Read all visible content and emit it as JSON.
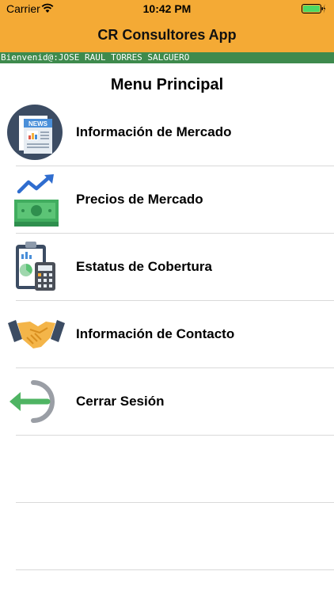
{
  "status_bar": {
    "carrier": "Carrier",
    "time": "10:42 PM",
    "wifi_icon": "wifi-icon",
    "battery_icon": "battery-charging-icon"
  },
  "navbar": {
    "title": "CR Consultores App"
  },
  "welcome": {
    "text": "Bienvenid@:JOSE RAUL TORRES SALGUERO"
  },
  "menu": {
    "title": "Menu Principal",
    "items": [
      {
        "label": "Información de Mercado",
        "icon": "news-icon"
      },
      {
        "label": "Precios de Mercado",
        "icon": "money-trend-icon"
      },
      {
        "label": "Estatus de Cobertura",
        "icon": "clipboard-calculator-icon"
      },
      {
        "label": "Información de Contacto",
        "icon": "handshake-icon"
      },
      {
        "label": "Cerrar Sesión",
        "icon": "logout-icon"
      }
    ]
  },
  "colors": {
    "navbar": "#f4aa35",
    "welcome_bar": "#3e8a4d"
  }
}
